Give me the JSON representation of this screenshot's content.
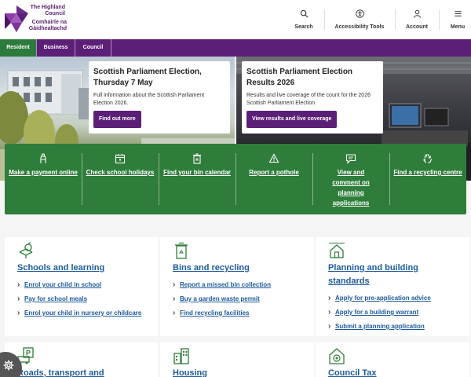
{
  "header": {
    "logo_line1": "The Highland Council",
    "logo_line2": "Comhairle na Gàidhealtachd",
    "nav": [
      {
        "label": "Search",
        "icon": "search-icon"
      },
      {
        "label": "Accessibility Tools",
        "icon": "accessibility-icon"
      },
      {
        "label": "Account",
        "icon": "user-icon"
      },
      {
        "label": "Menu",
        "icon": "menu-icon"
      }
    ]
  },
  "audience": {
    "tabs": [
      {
        "label": "Resident"
      },
      {
        "label": "Business"
      },
      {
        "label": "Council"
      }
    ]
  },
  "hero": {
    "cards": [
      {
        "title": "Scottish Parliament Election, Thursday 7 May",
        "text": "Full information about the Scottish Parliament Election 2026.",
        "button": "Find out more"
      },
      {
        "title": "Scottish Parliament Election Results 2026",
        "text": "Results and live coverage of the count for the 2026 Scottish Parliament Election",
        "button": "View results and live coverage"
      }
    ]
  },
  "quick_links": [
    {
      "label": "Make a payment online",
      "icon": "payment-icon"
    },
    {
      "label": "Check school holidays",
      "icon": "calendar-icon"
    },
    {
      "label": "Find your bin calendar",
      "icon": "bin-icon"
    },
    {
      "label": "Report a pothole",
      "icon": "pothole-icon"
    },
    {
      "label": "View and comment on planning applications",
      "icon": "comment-icon"
    },
    {
      "label": "Find a recycling centre",
      "icon": "recycle-icon"
    }
  ],
  "services": [
    {
      "title": "Schools and learning",
      "icon": "apple-book-icon",
      "links": [
        "Enrol your child in school",
        "Pay for school meals",
        "Enrol your child in nursery or childcare"
      ]
    },
    {
      "title": "Bins and recycling",
      "icon": "bin-icon",
      "links": [
        "Report a missed bin collection",
        "Buy a garden waste permit",
        "Find recycling facilities"
      ]
    },
    {
      "title": "Planning and building standards",
      "icon": "house-plan-icon",
      "links": [
        "Apply for pre-application advice",
        "Apply for a building warrant",
        "Submit a planning application"
      ]
    },
    {
      "title": "Roads, transport and",
      "icon": "parking-icon",
      "links": []
    },
    {
      "title": "Housing",
      "icon": "buildings-icon",
      "links": []
    },
    {
      "title": "Council Tax",
      "icon": "house-coin-icon",
      "links": []
    }
  ],
  "colors": {
    "brand_purple": "#5b1f78",
    "brand_green": "#2e7d3a",
    "link_blue": "#1d5a9a"
  }
}
